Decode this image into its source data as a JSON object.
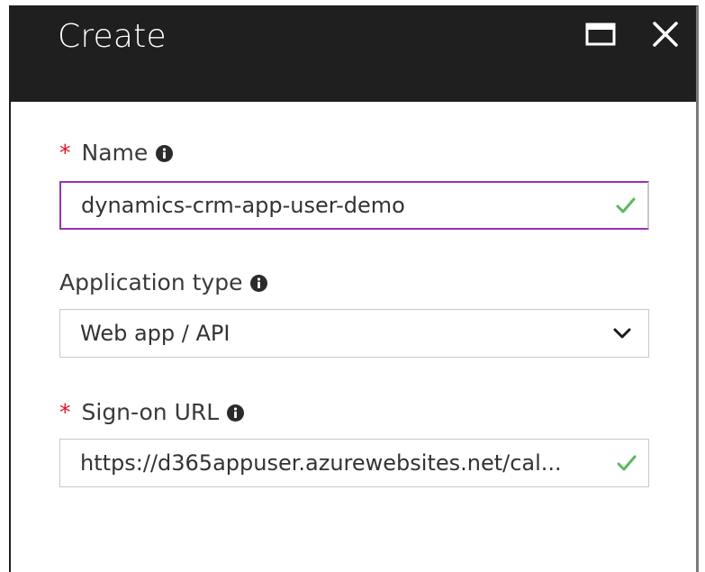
{
  "dialog": {
    "title": "Create",
    "header_color": "#1f1f1f",
    "maximize_icon": "maximize-icon",
    "close_icon": "close-icon"
  },
  "fields": {
    "name": {
      "label": "Name",
      "required": true,
      "required_marker": "*",
      "value": "dynamics-crm-app-user-demo",
      "valid": true
    },
    "application_type": {
      "label": "Application type",
      "required": false,
      "selected": "Web app / API"
    },
    "sign_on_url": {
      "label": "Sign-on URL",
      "required": true,
      "required_marker": "*",
      "value": "https://d365appuser.azurewebsites.net/cal...",
      "valid": true
    }
  },
  "colors": {
    "required_star": "#e81123",
    "valid_check": "#5cb85c",
    "focus_border": "#9b30b3"
  }
}
